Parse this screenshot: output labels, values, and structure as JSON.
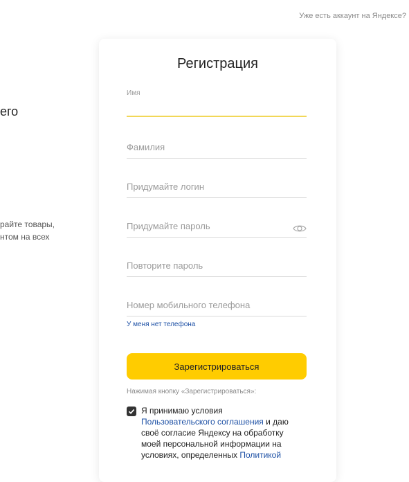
{
  "header": {
    "have_account_link": "Уже есть аккаунт на Яндексе?"
  },
  "left_panel": {
    "heading_fragment": "его",
    "text_line_1": "райте товары,",
    "text_line_2": "нтом на всех"
  },
  "form": {
    "title": "Регистрация",
    "first_name": {
      "label": "Имя",
      "value": ""
    },
    "last_name_placeholder": "Фамилия",
    "login_placeholder": "Придумайте логин",
    "password_placeholder": "Придумайте пароль",
    "password_repeat_placeholder": "Повторите пароль",
    "phone_placeholder": "Номер мобильного телефона",
    "no_phone_link": "У меня нет телефона",
    "register_button": "Зарегистрироваться",
    "terms_note": "Нажимая кнопку «Зарегистрироваться»:",
    "terms": {
      "checked": true,
      "text_1": "Я принимаю условия",
      "link_1": "Пользовательского соглашения",
      "text_2": " и даю своё согласие Яндексу на обработку моей персональной информации на условиях, определенных ",
      "link_2": "Политикой"
    }
  },
  "colors": {
    "accent_yellow": "#ffcc00",
    "active_underline": "#f2d758",
    "link_blue": "#1d50a5"
  }
}
